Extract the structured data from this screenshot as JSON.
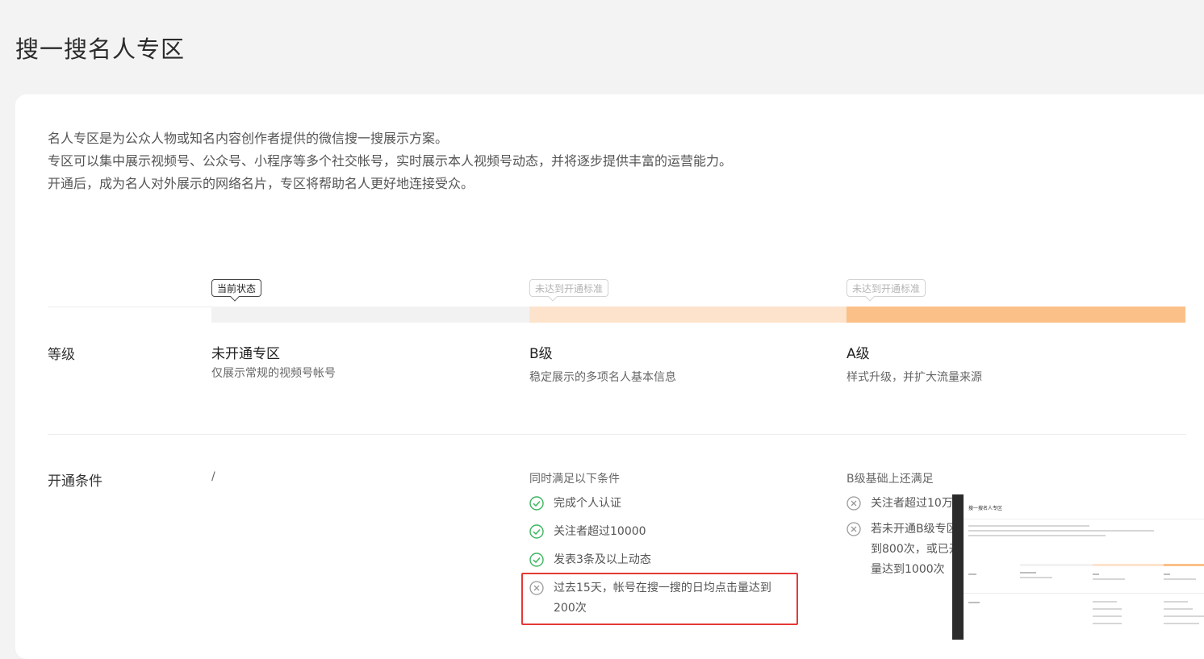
{
  "title": "搜一搜名人专区",
  "intro": [
    "名人专区是为公众人物或知名内容创作者提供的微信搜一搜展示方案。",
    "专区可以集中展示视频号、公众号、小程序等多个社交帐号，实时展示本人视频号动态，并将逐步提供丰富的运营能力。",
    "开通后，成为名人对外展示的网络名片，专区将帮助名人更好地连接受众。"
  ],
  "status_tags": {
    "current": "当前状态",
    "b": "未达到开通标准",
    "a": "未达到开通标准"
  },
  "colors": {
    "bar_none": "#f2f2f2",
    "bar_b": "#fde3cc",
    "bar_a": "#fbc088",
    "check": "#3bb65f",
    "cross": "#9a9a9a",
    "highlight": "#e53935"
  },
  "row_labels": {
    "level": "等级",
    "conditions": "开通条件"
  },
  "levels": [
    {
      "name": "未开通专区",
      "desc": "仅展示常规的视频号帐号"
    },
    {
      "name": "B级",
      "desc": "稳定展示的多项名人基本信息"
    },
    {
      "name": "A级",
      "desc": "样式升级，并扩大流量来源"
    }
  ],
  "conditions": {
    "none": "/",
    "b_header": "同时满足以下条件",
    "b_items": [
      {
        "text": "完成个人认证",
        "status": "check"
      },
      {
        "text": "关注者超过10000",
        "status": "check"
      },
      {
        "text": "发表3条及以上动态",
        "status": "check"
      },
      {
        "text_lines": [
          "过去15天，帐号在搜一搜的日均点击量达到",
          "200次"
        ],
        "status": "cross"
      }
    ],
    "a_header": "B级基础上还满足",
    "a_items": [
      {
        "text": "关注者超过10万",
        "status": "cross"
      },
      {
        "text_lines": [
          "若未开通B级专区，过去15天日均点击量达",
          "到800次，或已开通B级专区，日均点击",
          "量达到1000次"
        ],
        "status": "cross"
      }
    ]
  },
  "thumbnail": {
    "title": "搜一搜名人专区"
  }
}
